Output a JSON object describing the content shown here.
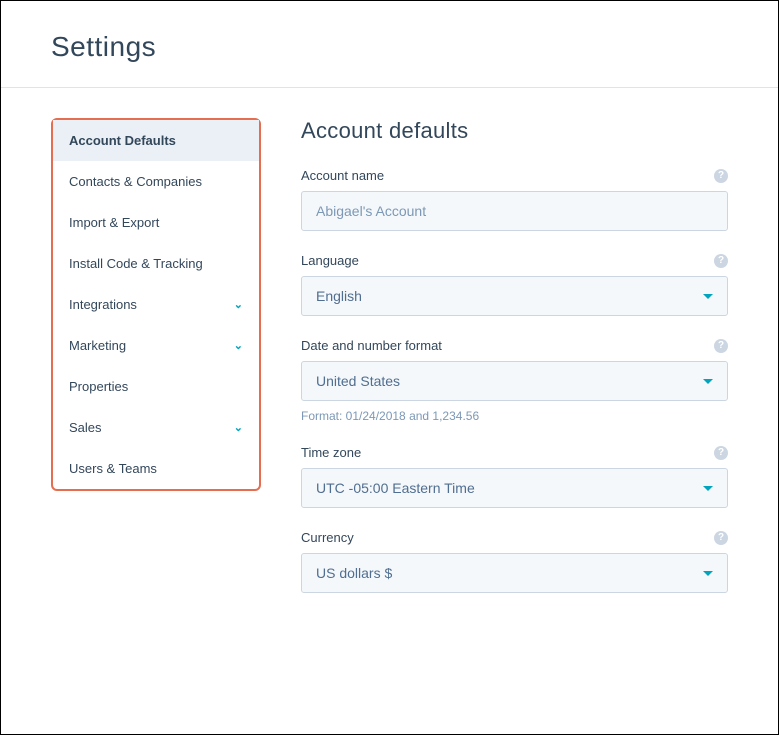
{
  "page": {
    "title": "Settings"
  },
  "sidebar": {
    "items": [
      {
        "label": "Account Defaults",
        "expandable": false,
        "active": true
      },
      {
        "label": "Contacts & Companies",
        "expandable": false,
        "active": false
      },
      {
        "label": "Import & Export",
        "expandable": false,
        "active": false
      },
      {
        "label": "Install Code & Tracking",
        "expandable": false,
        "active": false
      },
      {
        "label": "Integrations",
        "expandable": true,
        "active": false
      },
      {
        "label": "Marketing",
        "expandable": true,
        "active": false
      },
      {
        "label": "Properties",
        "expandable": false,
        "active": false
      },
      {
        "label": "Sales",
        "expandable": true,
        "active": false
      },
      {
        "label": "Users & Teams",
        "expandable": false,
        "active": false
      }
    ]
  },
  "main": {
    "title": "Account defaults",
    "account_name": {
      "label": "Account name",
      "value": "Abigael's Account"
    },
    "language": {
      "label": "Language",
      "value": "English"
    },
    "date_format": {
      "label": "Date and number format",
      "value": "United States",
      "hint": "Format: 01/24/2018 and 1,234.56"
    },
    "timezone": {
      "label": "Time zone",
      "value": "UTC -05:00 Eastern Time"
    },
    "currency": {
      "label": "Currency",
      "value": "US dollars $"
    }
  }
}
